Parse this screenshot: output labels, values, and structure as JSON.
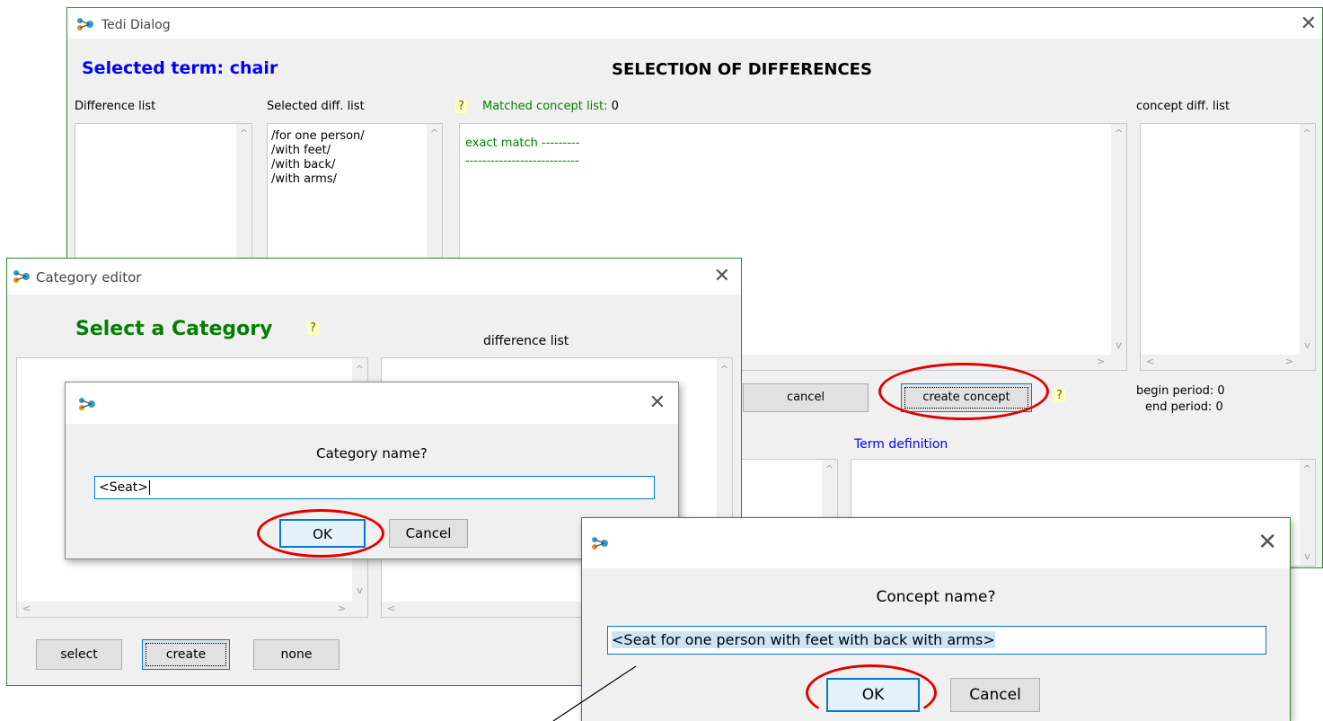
{
  "tedi": {
    "title": "Tedi Dialog",
    "selected_term": "Selected term: chair",
    "heading": "SELECTION OF DIFFERENCES",
    "difference_list_label": "Difference list",
    "selected_diff_label": "Selected diff. list",
    "selected_diffs": [
      "/for one person/",
      "/with feet/",
      "/with back/",
      "/with arms/"
    ],
    "help_mark": "?",
    "matched_label": "Matched concept list:",
    "matched_count": "0",
    "matched_lines": [
      "exact match ---------",
      "---------------------------"
    ],
    "concept_diff_label": "concept diff. list",
    "cancel_label": "cancel",
    "create_concept_label": "create concept",
    "begin_period": "begin period:  0",
    "end_period": "end period:  0",
    "term_definition_label": "Term definition"
  },
  "category_editor": {
    "title": "Category editor",
    "heading": "Select a Category",
    "help_mark": "?",
    "difference_list_label": "difference list",
    "select_label": "select",
    "create_label": "create",
    "none_label": "none"
  },
  "category_prompt": {
    "question": "Category name?",
    "value": "<Seat>",
    "ok_label": "OK",
    "cancel_label": "Cancel"
  },
  "concept_prompt": {
    "question": "Concept name?",
    "value": "<Seat for one person with feet with back with arms>",
    "ok_label": "OK",
    "cancel_label": "Cancel"
  },
  "colors": {
    "window_border": "#2a8a2a",
    "highlight_oval": "#e00000",
    "heading_blue": "#0000ff",
    "heading_green": "#008000"
  }
}
